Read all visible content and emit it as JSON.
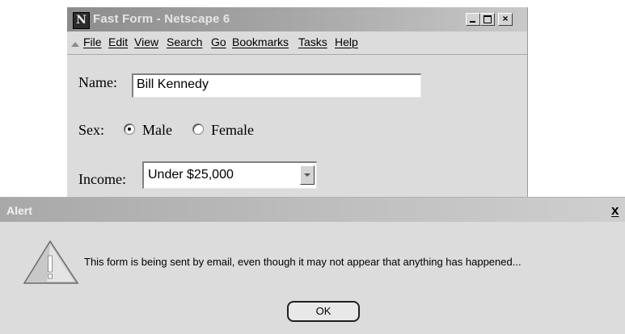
{
  "window": {
    "title": "Fast Form - Netscape 6",
    "logo_letter": "N",
    "controls": {
      "minimize": "_",
      "maximize": "□",
      "close": "×"
    }
  },
  "menu": {
    "items": [
      "File",
      "Edit",
      "View",
      "Search",
      "Go",
      "Bookmarks",
      "Tasks",
      "Help"
    ]
  },
  "form": {
    "name_label": "Name:",
    "name_value": "Bill Kennedy",
    "sex_label": "Sex:",
    "sex_options": [
      "Male",
      "Female"
    ],
    "sex_selected": "Male",
    "income_label": "Income:",
    "income_value": "Under $25,000"
  },
  "alert": {
    "title": "Alert",
    "close": "x",
    "message": "This form is being sent by email, even though it may not appear that anything has happened...",
    "ok_label": "OK"
  }
}
